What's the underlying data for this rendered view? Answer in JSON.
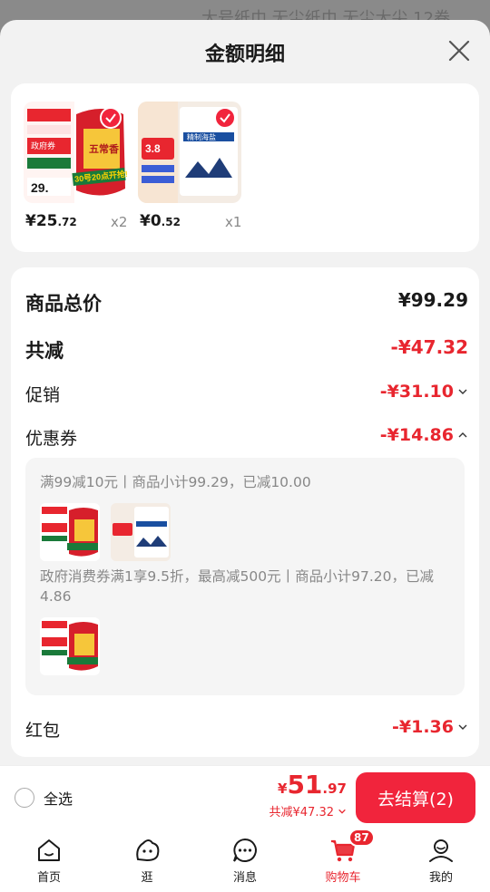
{
  "backdrop": {
    "text": "大号纸巾 无尘纸巾 无尘大尖 12卷"
  },
  "sheet": {
    "title": "金额明细"
  },
  "products": [
    {
      "price_int": "¥25",
      "price_dec": ".72",
      "qty": "x2",
      "thumb_text": [
        "30号20点开抢!",
        "五常香",
        "政府券",
        "29."
      ]
    },
    {
      "price_int": "¥0",
      "price_dec": ".52",
      "qty": "x1",
      "thumb_text": [
        "精制海盐",
        "3.8"
      ]
    }
  ],
  "summary": {
    "total_label": "商品总价",
    "total_value": "¥99.29",
    "reduce_label": "共减",
    "reduce_value": "-¥47.32",
    "promo_label": "促销",
    "promo_value": "-¥31.10",
    "coupon_label": "优惠券",
    "coupon_value": "-¥14.86",
    "coupon_lines": [
      "满99减10元丨商品小计99.29，已减10.00",
      "政府消费券满1享9.5折，最高减500元丨商品小计97.20，已减4.86"
    ],
    "redpack_label": "红包",
    "redpack_value": "-¥1.36"
  },
  "cart_bar": {
    "select_all": "全选",
    "yen": "¥",
    "total_int": "51",
    "total_dec": ".97",
    "reduce_text": "共减¥47.32",
    "checkout_label": "去结算(2)"
  },
  "tabbar": {
    "items": [
      {
        "label": "首页",
        "icon": "home-icon"
      },
      {
        "label": "逛",
        "icon": "browse-icon"
      },
      {
        "label": "消息",
        "icon": "message-icon"
      },
      {
        "label": "购物车",
        "icon": "cart-icon",
        "active": true,
        "badge": "87"
      },
      {
        "label": "我的",
        "icon": "profile-icon"
      }
    ]
  },
  "colors": {
    "accent": "#e8262f",
    "button": "#f1243c"
  }
}
